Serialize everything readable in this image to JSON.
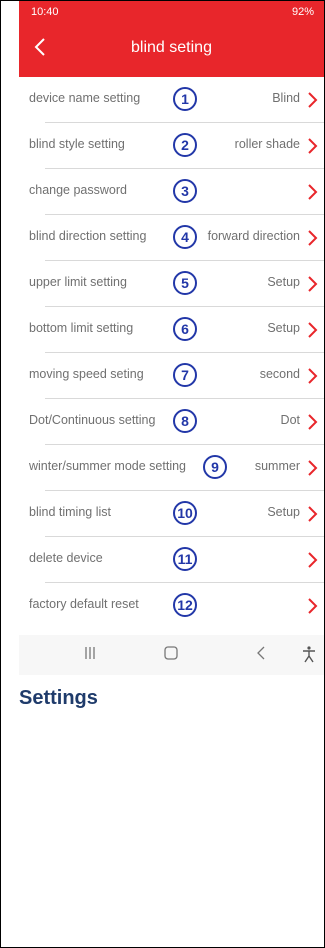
{
  "status": {
    "time": "10:40",
    "right": "92%"
  },
  "header": {
    "title": "blind seting"
  },
  "rows": [
    {
      "label": "device name setting",
      "num": "1",
      "value": "Blind"
    },
    {
      "label": "blind style setting",
      "num": "2",
      "value": "roller shade"
    },
    {
      "label": "change password",
      "num": "3",
      "value": ""
    },
    {
      "label": "blind direction setting",
      "num": "4",
      "value": "forward direction"
    },
    {
      "label": "upper limit setting",
      "num": "5",
      "value": "Setup"
    },
    {
      "label": "bottom limit setting",
      "num": "6",
      "value": "Setup"
    },
    {
      "label": "moving speed seting",
      "num": "7",
      "value": "second"
    },
    {
      "label": "Dot/Continuous setting",
      "num": "8",
      "value": "Dot"
    },
    {
      "label": "winter/summer mode setting",
      "num": "9",
      "value": "summer"
    },
    {
      "label": "blind timing list",
      "num": "10",
      "value": "Setup"
    },
    {
      "label": "delete device",
      "num": "11",
      "value": ""
    },
    {
      "label": "factory default reset",
      "num": "12",
      "value": ""
    }
  ],
  "heading": "Settings",
  "colors": {
    "accent": "#e8262b",
    "marker": "#2237a8"
  }
}
